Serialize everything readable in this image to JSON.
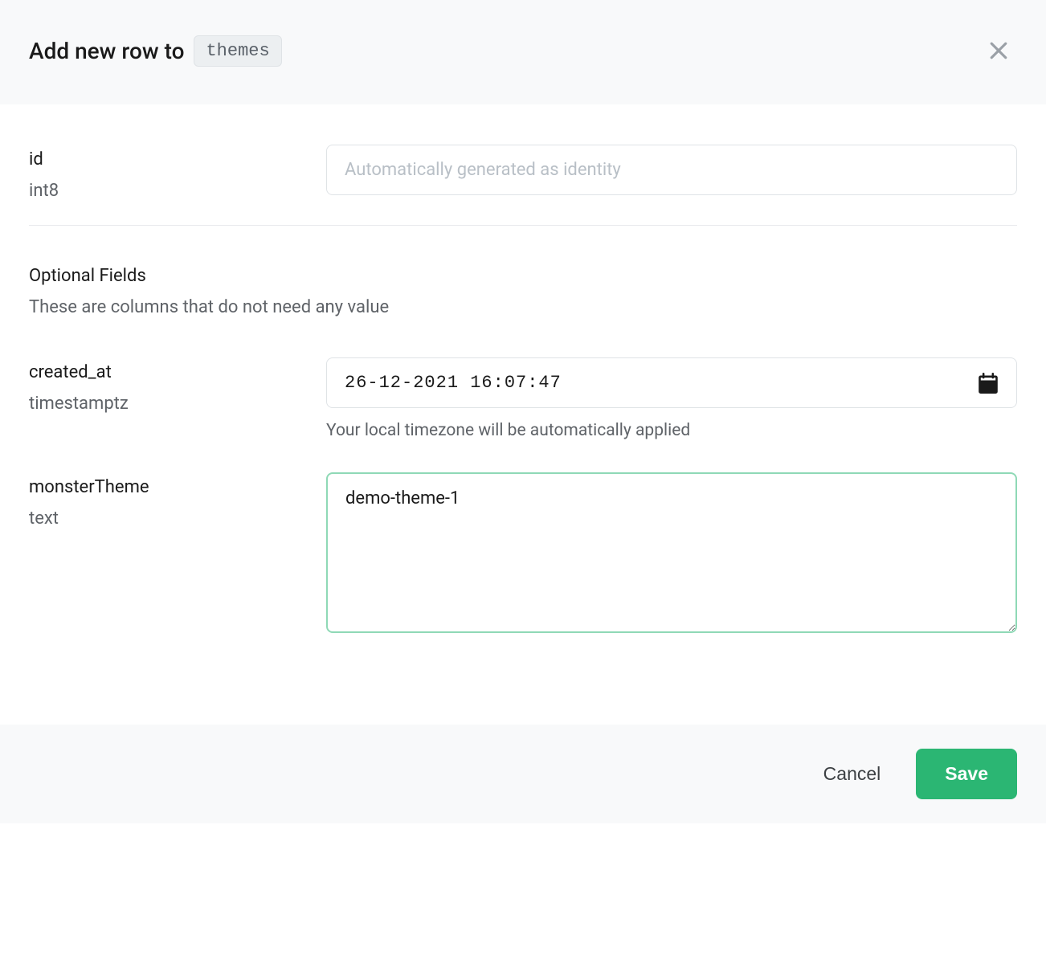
{
  "header": {
    "title_prefix": "Add new row to",
    "table_name": "themes"
  },
  "fields": {
    "id": {
      "name": "id",
      "type": "int8",
      "placeholder": "Automatically generated as identity",
      "value": ""
    },
    "created_at": {
      "name": "created_at",
      "type": "timestamptz",
      "value": "26-12-2021 16:07:47",
      "hint": "Your local timezone will be automatically applied"
    },
    "monsterTheme": {
      "name": "monsterTheme",
      "type": "text",
      "value": "demo-theme-1"
    }
  },
  "optional_section": {
    "title": "Optional Fields",
    "subtitle": "These are columns that do not need any value"
  },
  "footer": {
    "cancel_label": "Cancel",
    "save_label": "Save"
  }
}
